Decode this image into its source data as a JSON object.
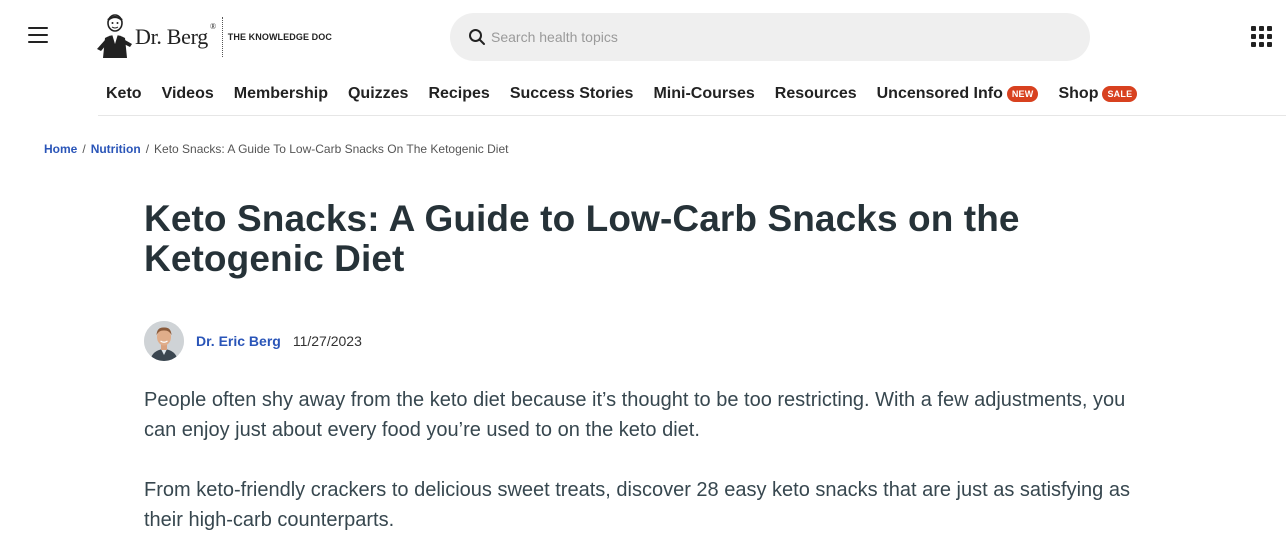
{
  "header": {
    "logo": {
      "name": "Dr. Berg",
      "registered": "®",
      "tagline": "THE KNOWLEDGE DOC"
    },
    "search": {
      "placeholder": "Search health topics",
      "value": ""
    },
    "menu_icon": "hamburger-icon",
    "apps_icon": "grid-icon"
  },
  "nav": {
    "items": [
      {
        "label": "Keto"
      },
      {
        "label": "Videos"
      },
      {
        "label": "Membership"
      },
      {
        "label": "Quizzes"
      },
      {
        "label": "Recipes"
      },
      {
        "label": "Success Stories"
      },
      {
        "label": "Mini-Courses"
      },
      {
        "label": "Resources"
      },
      {
        "label": "Uncensored Info",
        "badge": "NEW"
      },
      {
        "label": "Shop",
        "badge": "SALE"
      }
    ]
  },
  "breadcrumb": {
    "items": [
      "Home",
      "Nutrition"
    ],
    "separator": "/",
    "current": "Keto Snacks: A Guide To Low-Carb Snacks On The Ketogenic Diet"
  },
  "article": {
    "title": "Keto Snacks: A Guide to Low-Carb Snacks on the Ketogenic Diet",
    "author": "Dr. Eric Berg",
    "date": "11/27/2023",
    "paragraphs": [
      "People often shy away from the keto diet because it’s thought to be too restricting. With a few adjustments, you can enjoy just about every food you’re used to on the keto diet.",
      "From keto-friendly crackers to delicious sweet treats, discover 28 easy keto snacks that are just as satisfying as their high-carb counterparts."
    ]
  },
  "colors": {
    "link": "#2a55b8",
    "badge": "#d8411f",
    "title": "#263238",
    "body_text": "#37474f",
    "search_bg": "#efefef"
  }
}
